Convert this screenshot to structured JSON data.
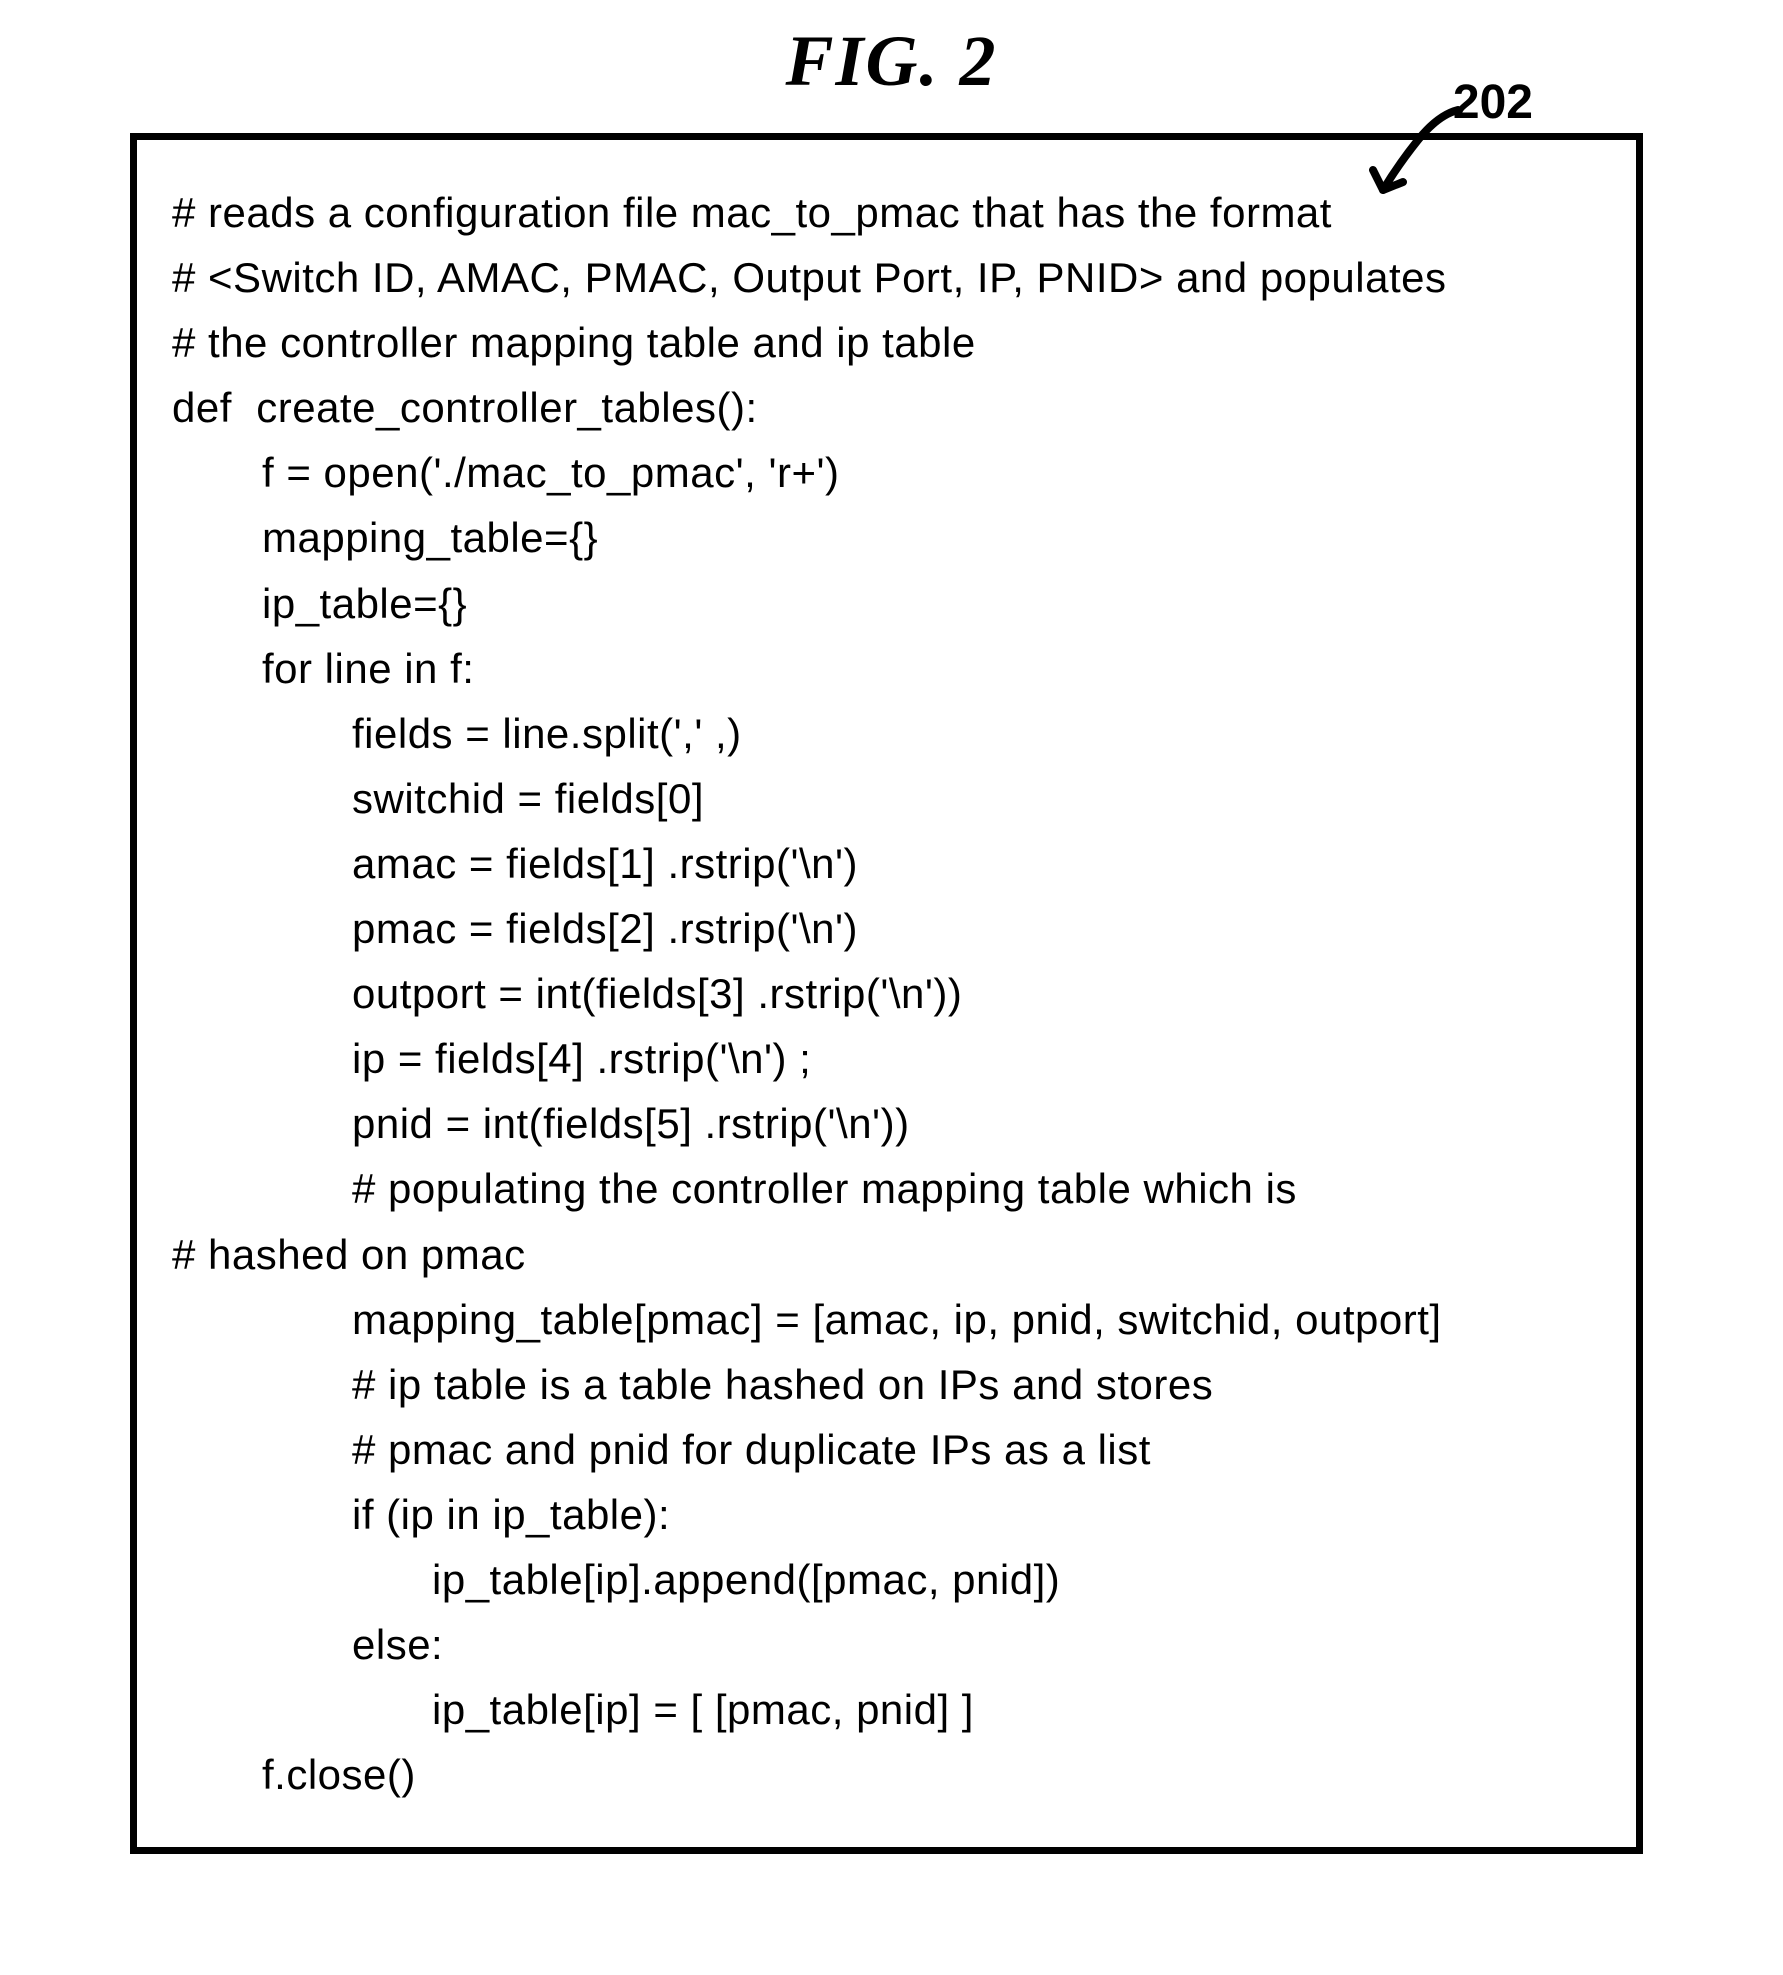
{
  "figure": {
    "title": "FIG.  2",
    "ref_number": "202"
  },
  "code": {
    "lines": [
      {
        "indent": 0,
        "text": "# reads a configuration file mac_to_pmac that has the format"
      },
      {
        "indent": 0,
        "text": "# <Switch ID, AMAC, PMAC, Output Port, IP, PNID> and populates"
      },
      {
        "indent": 0,
        "text": "# the controller mapping table and ip table"
      },
      {
        "indent": 0,
        "text": "def  create_controller_tables():"
      },
      {
        "indent": 1,
        "text": "f = open('./mac_to_pmac', 'r+')"
      },
      {
        "indent": 1,
        "text": "mapping_table={}"
      },
      {
        "indent": 1,
        "text": "ip_table={}"
      },
      {
        "indent": 1,
        "text": "for line in f:"
      },
      {
        "indent": 2,
        "text": "fields = line.split(',' ,)"
      },
      {
        "indent": 2,
        "text": "switchid = fields[0]"
      },
      {
        "indent": 2,
        "text": "amac = fields[1] .rstrip('\\n')"
      },
      {
        "indent": 2,
        "text": "pmac = fields[2] .rstrip('\\n')"
      },
      {
        "indent": 2,
        "text": "outport = int(fields[3] .rstrip('\\n'))"
      },
      {
        "indent": 2,
        "text": "ip = fields[4] .rstrip('\\n') ;"
      },
      {
        "indent": 2,
        "text": "pnid = int(fields[5] .rstrip('\\n'))"
      },
      {
        "indent": 2,
        "text": "# populating the controller mapping table which is"
      },
      {
        "indent": 0,
        "text": "# hashed on pmac"
      },
      {
        "indent": 2,
        "text": "mapping_table[pmac] = [amac, ip, pnid, switchid, outport]"
      },
      {
        "indent": 2,
        "text": "# ip table is a table hashed on IPs and stores"
      },
      {
        "indent": 2,
        "text": "# pmac and pnid for duplicate IPs as a list"
      },
      {
        "indent": 2,
        "text": "if (ip in ip_table):"
      },
      {
        "indent": 3,
        "text": "ip_table[ip].append([pmac, pnid])"
      },
      {
        "indent": 2,
        "text": "else:"
      },
      {
        "indent": 3,
        "text": "ip_table[ip] = [ [pmac, pnid] ]"
      },
      {
        "indent": 1,
        "text": "f.close()"
      }
    ]
  }
}
